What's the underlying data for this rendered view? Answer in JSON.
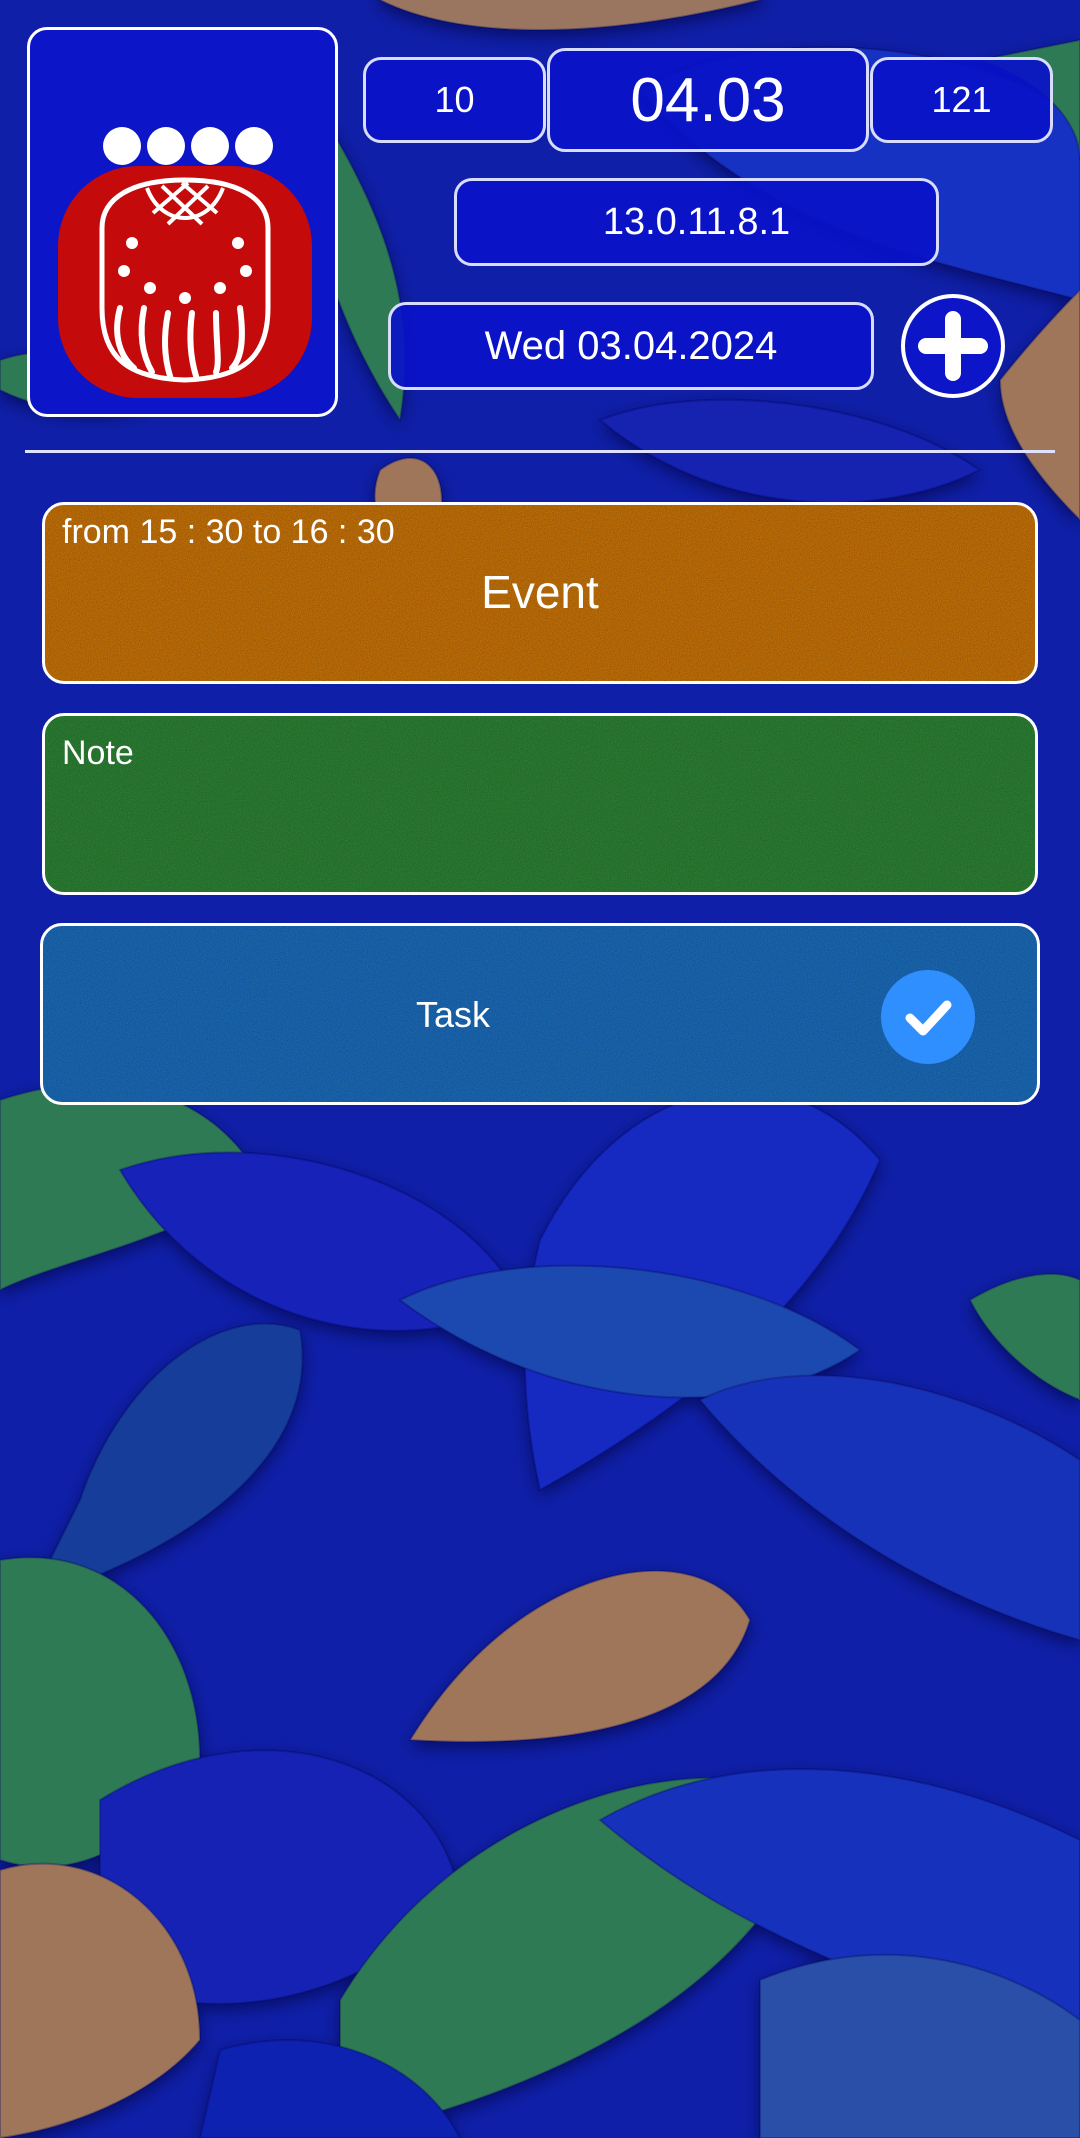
{
  "header": {
    "glyph": {
      "dot_count": 4,
      "icon": "maya-day-sign-glyph"
    },
    "left_number": "10",
    "center_date": "04.03",
    "right_number": "121",
    "long_count": "13.0.11.8.1",
    "gregorian_date": "Wed 03.04.2024",
    "add_button_icon": "plus-icon"
  },
  "entries": [
    {
      "type": "event",
      "time_text": "from 15 : 30 to 16 : 30",
      "title": "Event",
      "color": "#d47a08"
    },
    {
      "type": "note",
      "title": "Note",
      "color": "#2f8a38"
    },
    {
      "type": "task",
      "title": "Task",
      "color": "#1c72c6",
      "done": true,
      "check_icon": "check-icon"
    }
  ],
  "colors": {
    "panel": "#0d15c8",
    "border": "#ffffff",
    "glyph_red": "#c40a0a",
    "background_leaf_blue": "#1a2bb8",
    "background_leaf_green": "#2f7a55",
    "background_leaf_brown": "#a0765a"
  }
}
